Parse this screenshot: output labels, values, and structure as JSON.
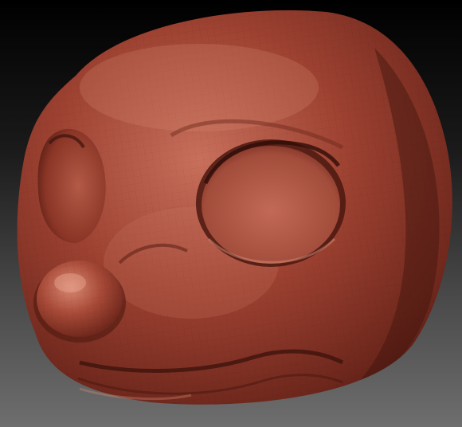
{
  "scene": {
    "subject": "sculpted-head-model",
    "colors": {
      "background_top": "#000000",
      "background_bottom": "#6e6e6e",
      "clay_base": "#9a3f30",
      "clay_light": "#c8705c",
      "clay_shadow": "#5a1f16"
    }
  }
}
